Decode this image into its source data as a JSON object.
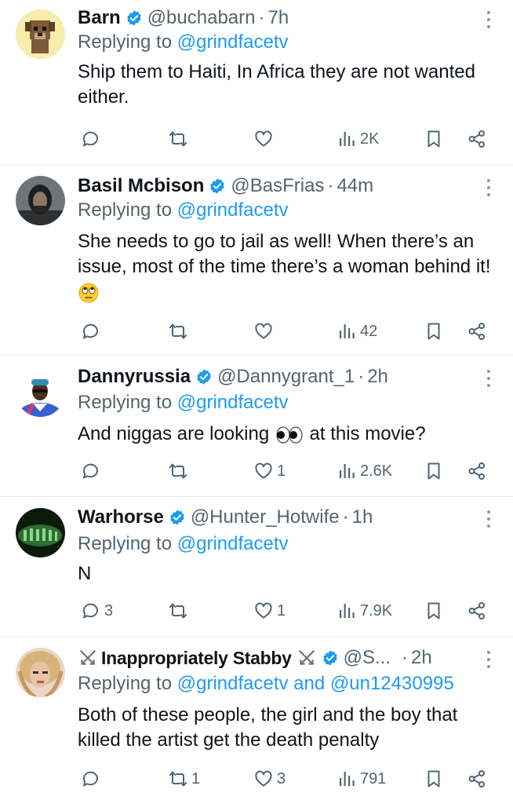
{
  "tweets": [
    {
      "name": "Barn",
      "handle": "@buchabarn",
      "time": "7h",
      "replying_prefix": "Replying to ",
      "replying_to": "@grindfacetv",
      "text": "Ship them to Haiti, In Africa they are not wanted either.",
      "replies": "",
      "reposts": "",
      "likes": "",
      "views": "2K"
    },
    {
      "name": "Basil Mcbison",
      "handle": "@BasFrias",
      "time": "44m",
      "replying_prefix": "Replying to ",
      "replying_to": "@grindfacetv",
      "text": "She needs to go to jail as well! When there’s an issue, most of the time there’s a woman behind it!",
      "emoji": "face-with-rolling-eyes",
      "replies": "",
      "reposts": "",
      "likes": "",
      "views": "42"
    },
    {
      "name": "Dannyrussia",
      "handle": "@Dannygrant_1",
      "time": "2h",
      "replying_prefix": "Replying to ",
      "replying_to": "@grindfacetv",
      "text_before": "And niggas are looking",
      "emoji": "eyes",
      "text_after": "at this movie?",
      "replies": "",
      "reposts": "",
      "likes": "1",
      "views": "2.6K"
    },
    {
      "name": "Warhorse",
      "handle": "@Hunter_Hotwife",
      "time": "1h",
      "replying_prefix": "Replying to ",
      "replying_to": "@grindfacetv",
      "text": "N",
      "replies": "3",
      "reposts": "",
      "likes": "1",
      "views": "7.9K"
    },
    {
      "name": "Inappropriately Stabby",
      "handle": "@S...",
      "time": "2h",
      "replying_prefix": "Replying to ",
      "replying_to": "@grindfacetv and @un12430995",
      "text": "Both of these people, the girl and the boy that killed the artist get the death penalty",
      "replies": "",
      "reposts": "1",
      "likes": "3",
      "views": "791"
    }
  ],
  "colors": {
    "link": "#1d9bf0",
    "muted": "#536471",
    "text": "#0f1419",
    "verified": "#1d9bf0"
  },
  "icons": [
    "verified-badge-icon",
    "more-icon",
    "reply-icon",
    "repost-icon",
    "like-icon",
    "views-icon",
    "bookmark-icon",
    "share-icon"
  ]
}
